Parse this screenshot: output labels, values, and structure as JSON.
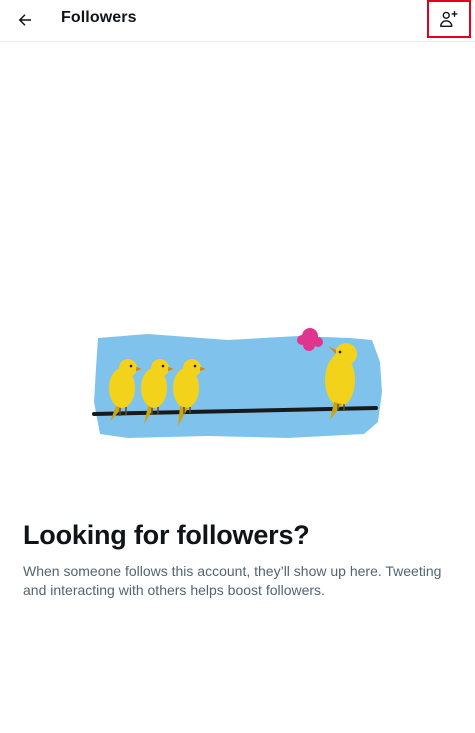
{
  "header": {
    "title": "Followers",
    "back_icon": "arrow-left-icon",
    "add_icon": "person-plus-icon"
  },
  "empty_state": {
    "illustration": "canaries-on-wire",
    "title": "Looking for followers?",
    "description": "When someone follows this account, they’ll show up here. Tweeting and interacting with others helps boost followers."
  },
  "colors": {
    "highlight_border": "#e3001b",
    "sky": "#7fc3ec",
    "bird": "#f2d21a",
    "bubble": "#e0358f",
    "text_primary": "#0f1419",
    "text_secondary": "#536471"
  }
}
